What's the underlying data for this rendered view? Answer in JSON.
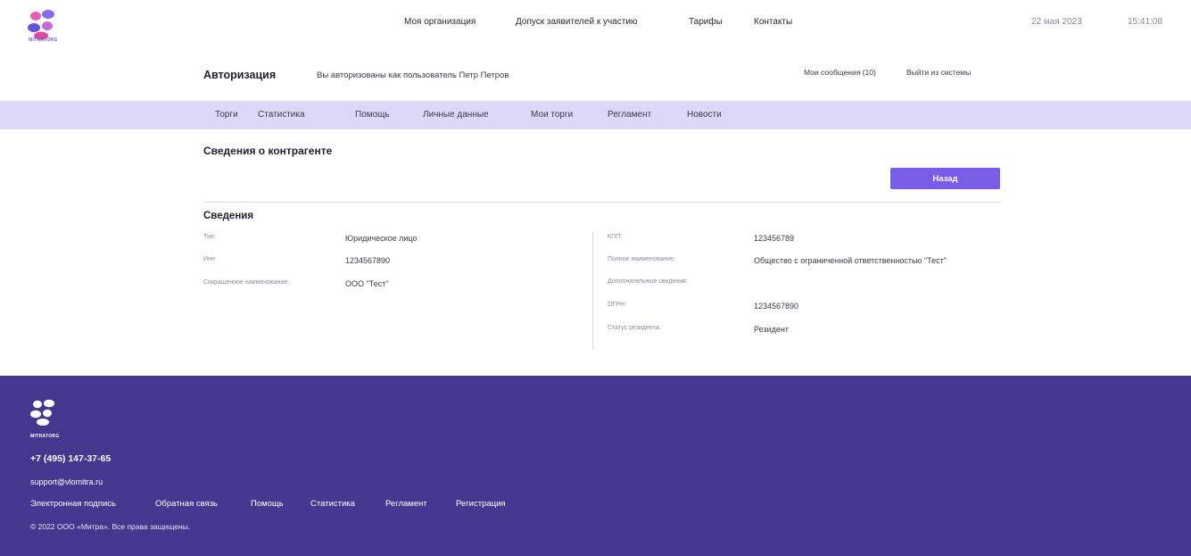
{
  "brand": {
    "logo_text": "MITRATORG"
  },
  "topnav": {
    "items": [
      "Моя организация",
      "Допуск заявителей к участию",
      "Тарифы",
      "Контакты"
    ],
    "date": "22 мая 2023",
    "time": "15:41:08"
  },
  "auth": {
    "title": "Авторизация",
    "text": "Вы авторизованы как пользователь  Петр Петров",
    "messages": "Мои сообщения (10)",
    "logout": "Выйти из системы"
  },
  "menu": {
    "items": [
      "Торги",
      "Статистика",
      "Помощь",
      "Личные данные",
      "Мои торги",
      "Регламент",
      "Новости"
    ]
  },
  "main": {
    "title": "Сведения о контрагенте",
    "back_label": "Назад",
    "info_title": "Сведения",
    "left_fields": [
      {
        "label": "Тип:",
        "value": "Юридическое лицо"
      },
      {
        "label": "Инн:",
        "value": "1234567890"
      },
      {
        "label": "Сокращенное наименование:",
        "value": "ООО \"Тест\""
      }
    ],
    "right_fields": [
      {
        "label": "КПП:",
        "value": "123456789"
      },
      {
        "label": "Полное наименование:",
        "value": "Общество с ограниченной ответственностью \"Тест\""
      },
      {
        "label": "Дополнительные сведения:",
        "value": ""
      },
      {
        "label": "ОГРН:",
        "value": "1234567890"
      },
      {
        "label": "Статус резидента:",
        "value": "Резидент"
      }
    ]
  },
  "footer": {
    "logo_text": "MITRATORG",
    "phone": "+7 (495) 147-37-65",
    "email": "support@vlomitra.ru",
    "links": [
      "Электронная подпись",
      "Обратная связь",
      "Помощь",
      "Статистика",
      "Регламент",
      "Регистрация"
    ],
    "copyright": "© 2022 ООО «Митра». Все права защищены."
  },
  "colors": {
    "accent": "#7b5ce6",
    "menu_band": "#ddd8f7",
    "footer_bg": "#45368f"
  }
}
